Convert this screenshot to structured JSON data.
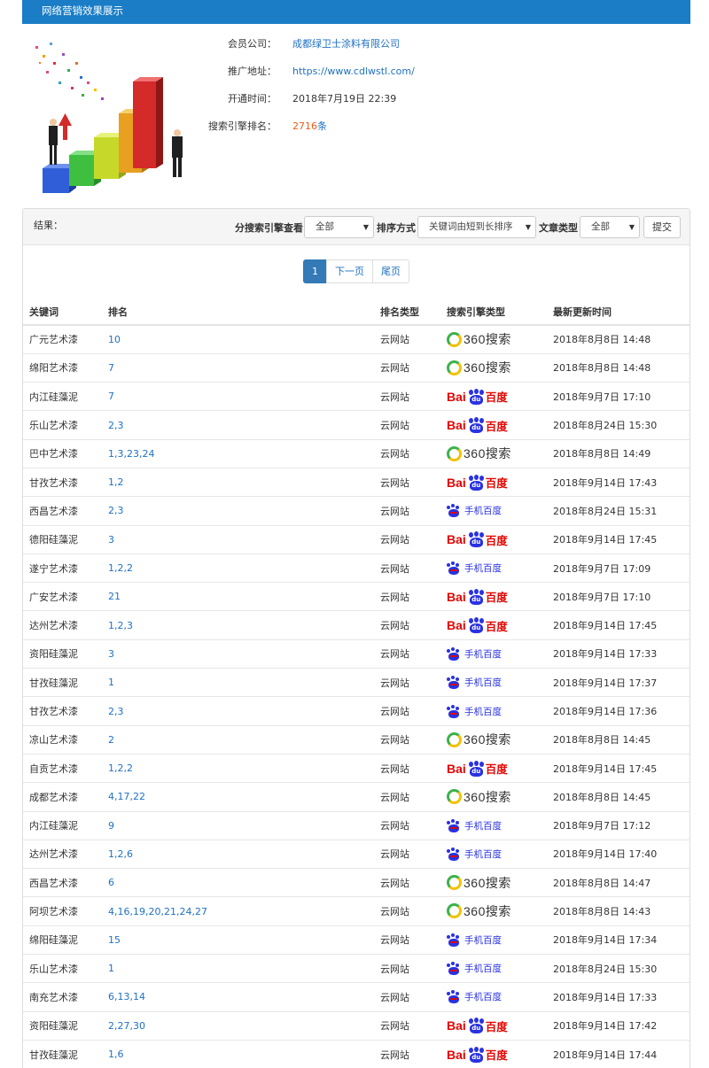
{
  "header": {
    "title": "网络营销效果展示"
  },
  "member": {
    "company_label": "会员公司：",
    "company": "成都绿卫士涂料有限公司",
    "url_label": "推广地址：",
    "url": "https://www.cdlwstl.com/",
    "open_label": "开通时间：",
    "open_time": "2018年7月19日 22:39",
    "rank_label": "搜索引擎排名：",
    "rank_count": "2716",
    "rank_unit": "条"
  },
  "toolbar": {
    "result_label": "结果：",
    "engine_label": "分搜索引擎查看",
    "engine_value": "全部",
    "sort_label": "排序方式",
    "sort_value": "关键词由短到长排序",
    "article_label": "文章类型",
    "article_value": "全部",
    "submit_label": "提交"
  },
  "pager": {
    "current": "1",
    "next": "下一页",
    "last": "尾页"
  },
  "table": {
    "headers": [
      "关键词",
      "排名",
      "排名类型",
      "搜索引擎类型",
      "最新更新时间"
    ],
    "rows": [
      {
        "keyword": "广元艺术漆",
        "rank": "10",
        "type": "云网站",
        "engine": "360",
        "time": "2018年8月8日 14:48"
      },
      {
        "keyword": "绵阳艺术漆",
        "rank": "7",
        "type": "云网站",
        "engine": "360",
        "time": "2018年8月8日 14:48"
      },
      {
        "keyword": "内江硅藻泥",
        "rank": "7",
        "type": "云网站",
        "engine": "baidu",
        "time": "2018年9月7日 17:10"
      },
      {
        "keyword": "乐山艺术漆",
        "rank": "2,3",
        "type": "云网站",
        "engine": "baidu",
        "time": "2018年8月24日 15:30"
      },
      {
        "keyword": "巴中艺术漆",
        "rank": "1,3,23,24",
        "type": "云网站",
        "engine": "360",
        "time": "2018年8月8日 14:49"
      },
      {
        "keyword": "甘孜艺术漆",
        "rank": "1,2",
        "type": "云网站",
        "engine": "baidu",
        "time": "2018年9月14日 17:43"
      },
      {
        "keyword": "西昌艺术漆",
        "rank": "2,3",
        "type": "云网站",
        "engine": "mobile",
        "time": "2018年8月24日 15:31"
      },
      {
        "keyword": "德阳硅藻泥",
        "rank": "3",
        "type": "云网站",
        "engine": "baidu",
        "time": "2018年9月14日 17:45"
      },
      {
        "keyword": "遂宁艺术漆",
        "rank": "1,2,2",
        "type": "云网站",
        "engine": "mobile",
        "time": "2018年9月7日 17:09"
      },
      {
        "keyword": "广安艺术漆",
        "rank": "21",
        "type": "云网站",
        "engine": "baidu",
        "time": "2018年9月7日 17:10"
      },
      {
        "keyword": "达州艺术漆",
        "rank": "1,2,3",
        "type": "云网站",
        "engine": "baidu",
        "time": "2018年9月14日 17:45"
      },
      {
        "keyword": "资阳硅藻泥",
        "rank": "3",
        "type": "云网站",
        "engine": "mobile",
        "time": "2018年9月14日 17:33"
      },
      {
        "keyword": "甘孜硅藻泥",
        "rank": "1",
        "type": "云网站",
        "engine": "mobile",
        "time": "2018年9月14日 17:37"
      },
      {
        "keyword": "甘孜艺术漆",
        "rank": "2,3",
        "type": "云网站",
        "engine": "mobile",
        "time": "2018年9月14日 17:36"
      },
      {
        "keyword": "凉山艺术漆",
        "rank": "2",
        "type": "云网站",
        "engine": "360",
        "time": "2018年8月8日 14:45"
      },
      {
        "keyword": "自贡艺术漆",
        "rank": "1,2,2",
        "type": "云网站",
        "engine": "baidu",
        "time": "2018年9月14日 17:45"
      },
      {
        "keyword": "成都艺术漆",
        "rank": "4,17,22",
        "type": "云网站",
        "engine": "360",
        "time": "2018年8月8日 14:45"
      },
      {
        "keyword": "内江硅藻泥",
        "rank": "9",
        "type": "云网站",
        "engine": "mobile",
        "time": "2018年9月7日 17:12"
      },
      {
        "keyword": "达州艺术漆",
        "rank": "1,2,6",
        "type": "云网站",
        "engine": "mobile",
        "time": "2018年9月14日 17:40"
      },
      {
        "keyword": "西昌艺术漆",
        "rank": "6",
        "type": "云网站",
        "engine": "360",
        "time": "2018年8月8日 14:47"
      },
      {
        "keyword": "阿坝艺术漆",
        "rank": "4,16,19,20,21,24,27",
        "type": "云网站",
        "engine": "360",
        "time": "2018年8月8日 14:43"
      },
      {
        "keyword": "绵阳硅藻泥",
        "rank": "15",
        "type": "云网站",
        "engine": "mobile",
        "time": "2018年9月14日 17:34"
      },
      {
        "keyword": "乐山艺术漆",
        "rank": "1",
        "type": "云网站",
        "engine": "mobile",
        "time": "2018年8月24日 15:30"
      },
      {
        "keyword": "南充艺术漆",
        "rank": "6,13,14",
        "type": "云网站",
        "engine": "mobile",
        "time": "2018年9月14日 17:33"
      },
      {
        "keyword": "资阳硅藻泥",
        "rank": "2,27,30",
        "type": "云网站",
        "engine": "baidu",
        "time": "2018年9月14日 17:42"
      },
      {
        "keyword": "甘孜硅藻泥",
        "rank": "1,6",
        "type": "云网站",
        "engine": "baidu",
        "time": "2018年9月14日 17:44"
      }
    ]
  },
  "logos": {
    "360_text": "360搜索",
    "baidu_bai": "Bai",
    "baidu_du": "du",
    "baidu_cn": "百度",
    "mobile_text": "手机百度"
  },
  "colors": {
    "header_blue": "#1a7dc6",
    "link_blue": "#1f71c4",
    "accent_orange": "#ee5a15",
    "baidu_red": "#e10602",
    "baidu_blue": "#2932e1",
    "green_360": "#3db24b"
  }
}
